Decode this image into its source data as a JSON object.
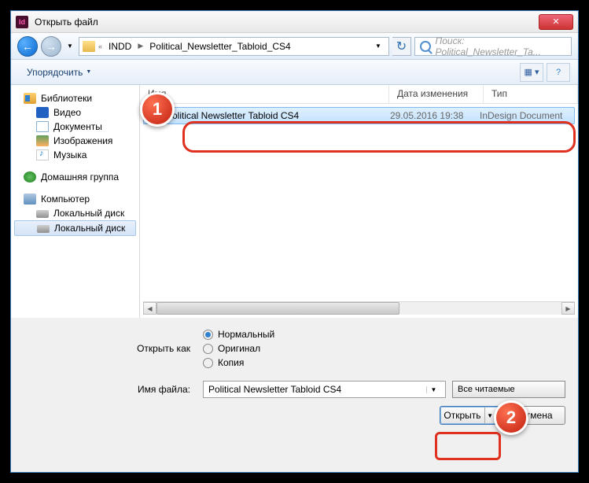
{
  "title": "Открыть файл",
  "breadcrumb": {
    "level1": "INDD",
    "level2": "Political_Newsletter_Tabloid_CS4"
  },
  "search_placeholder": "Поиск: Political_Newsletter_Ta...",
  "toolbar": {
    "organize": "Упорядочить"
  },
  "tree": {
    "libraries": "Библиотеки",
    "video": "Видео",
    "docs": "Документы",
    "images": "Изображения",
    "music": "Музыка",
    "homegroup": "Домашняя группа",
    "computer": "Компьютер",
    "disk1": "Локальный диск",
    "disk2": "Локальный диск"
  },
  "columns": {
    "name": "Имя",
    "date": "Дата изменения",
    "type": "Тип"
  },
  "file": {
    "name": "Political Newsletter Tabloid CS4",
    "date": "29.05.2016 19:38",
    "type": "InDesign Document"
  },
  "open_as": {
    "label": "Открыть как",
    "normal": "Нормальный",
    "original": "Оригинал",
    "copy": "Копия"
  },
  "filename_label": "Имя файла:",
  "filename_value": "Political Newsletter Tabloid CS4",
  "filter": "Все читаемые",
  "buttons": {
    "open": "Открыть",
    "cancel": "Отмена"
  },
  "callouts": {
    "c1": "1",
    "c2": "2"
  }
}
